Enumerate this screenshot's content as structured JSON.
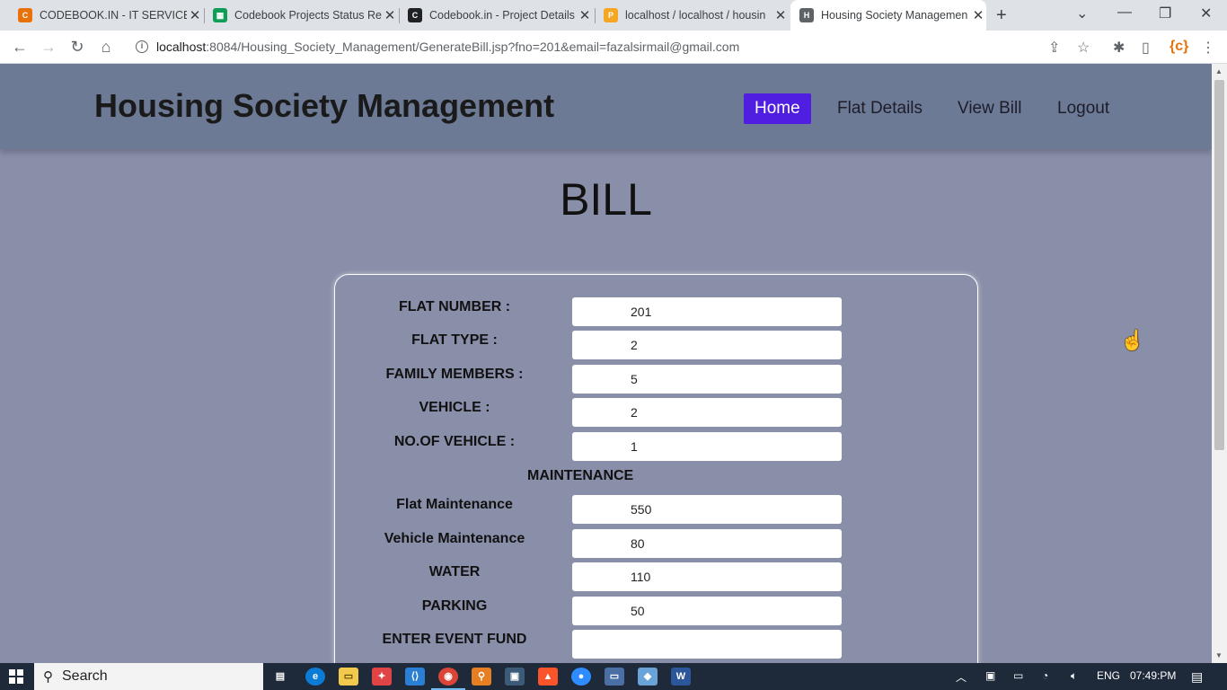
{
  "browser": {
    "tabs": [
      {
        "title": "CODEBOOK.IN - IT SERVICES",
        "favicon": "codebook-icon",
        "color": "#e8710a"
      },
      {
        "title": "Codebook Projects Status Re",
        "favicon": "sheets-icon",
        "color": "#0f9d58"
      },
      {
        "title": "Codebook.in - Project Details",
        "favicon": "codebook-dark-icon",
        "color": "#202124"
      },
      {
        "title": "localhost / localhost / housin",
        "favicon": "phpmyadmin-icon",
        "color": "#f5a623"
      },
      {
        "title": "Housing Society Managemen",
        "favicon": "housing-icon",
        "color": "#5f6368"
      }
    ],
    "url_host": "localhost",
    "url_rest": ":8084/Housing_Society_Management/GenerateBill.jsp?fno=201&email=fazalsirmail@gmail.com"
  },
  "site": {
    "brand": "Housing Society Management",
    "nav": [
      "Home",
      "Flat Details",
      "View Bill",
      "Logout"
    ],
    "accent": "#4f1ee0"
  },
  "bill": {
    "title": "BILL",
    "fields": [
      {
        "label": "FLAT NUMBER :",
        "value": "201"
      },
      {
        "label": "FLAT TYPE :",
        "value": "2"
      },
      {
        "label": "FAMILY MEMBERS :",
        "value": "5"
      },
      {
        "label": "VEHICLE :",
        "value": "2"
      },
      {
        "label": "NO.OF VEHICLE :",
        "value": "1"
      }
    ],
    "section": "MAINTENANCE",
    "maintenance": [
      {
        "label": "Flat Maintenance",
        "value": "550"
      },
      {
        "label": "Vehicle Maintenance",
        "value": "80"
      },
      {
        "label": "WATER",
        "value": "110"
      },
      {
        "label": "PARKING",
        "value": "50"
      },
      {
        "label": "ENTER EVENT FUND",
        "value": ""
      }
    ]
  },
  "taskbar": {
    "search": "Search",
    "lang": "ENG",
    "time": "07:49:PM"
  }
}
